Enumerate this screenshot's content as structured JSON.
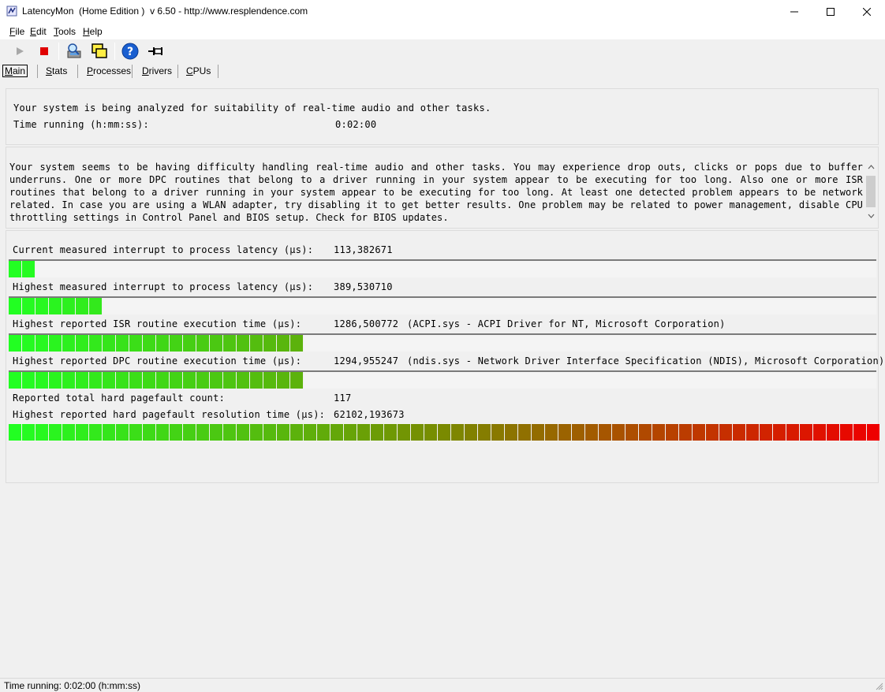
{
  "window": {
    "title": "LatencyMon  (Home Edition )  v 6.50 - http://www.resplendence.com"
  },
  "menu": [
    {
      "label": "File",
      "accel": "F",
      "rest": "ile"
    },
    {
      "label": "Edit",
      "accel": "E",
      "rest": "dit"
    },
    {
      "label": "Tools",
      "accel": "T",
      "rest": "ools"
    },
    {
      "label": "Help",
      "accel": "H",
      "rest": "elp"
    }
  ],
  "tabs": [
    {
      "label": "Main",
      "accel": "M",
      "rest": "ain",
      "active": true
    },
    {
      "label": "Stats",
      "accel": "S",
      "rest": "tats",
      "active": false
    },
    {
      "label": "Processes",
      "accel": "P",
      "rest": "rocesses",
      "active": false
    },
    {
      "label": "Drivers",
      "accel": "D",
      "rest": "rivers",
      "active": false
    },
    {
      "label": "CPUs",
      "accel": "C",
      "rest": "PUs",
      "active": false
    }
  ],
  "analysis": {
    "status": "Your system is being analyzed for suitability of real-time audio and other tasks.",
    "time_label": "Time running (h:mm:ss):",
    "time_value": "0:02:00"
  },
  "advice": "Your system seems to be having difficulty handling real-time audio and other tasks. You may experience drop outs, clicks or pops due to buffer underruns. One or more DPC routines that belong to a driver running in your system appear to be executing for too long. Also one or more ISR routines that belong to a driver running in your system appear to be executing for too long. At least one detected problem appears to be network related. In case you are using a WLAN adapter, try disabling it to get better results. One problem may be related to power management, disable CPU throttling settings in Control Panel and BIOS setup. Check for BIOS updates.",
  "metrics": {
    "current_latency": {
      "label": "Current measured interrupt to process latency (µs):",
      "value": "113,382671",
      "segments": 2
    },
    "highest_latency": {
      "label": "Highest measured interrupt to process latency (µs):",
      "value": "389,530710",
      "segments": 7
    },
    "isr": {
      "label": "Highest reported ISR routine execution time (µs):",
      "value": "1286,500772",
      "detail": "(ACPI.sys - ACPI Driver for NT, Microsoft Corporation)",
      "segments": 22
    },
    "dpc": {
      "label": "Highest reported DPC routine execution time (µs):",
      "value": "1294,955247",
      "detail": "(ndis.sys - Network Driver Interface Specification (NDIS), Microsoft Corporation)",
      "segments": 22
    },
    "pagefault_count": {
      "label": "Reported total hard pagefault count:",
      "value": "117"
    },
    "pagefault_time": {
      "label": "Highest reported hard pagefault resolution time (µs):",
      "value": "62102,193673",
      "segments": 65
    }
  },
  "bar_total_segments": 65,
  "colors": {
    "bar_start": "#22ff22",
    "bar_mid": "#7a8a00",
    "bar_end": "#ee0000"
  },
  "statusbar": {
    "text": "Time running: 0:02:00  (h:mm:ss)"
  },
  "icons": [
    "app-icon",
    "play-icon",
    "stop-icon",
    "cpu-scan-icon",
    "windows-icon",
    "help-icon",
    "pin-icon"
  ]
}
